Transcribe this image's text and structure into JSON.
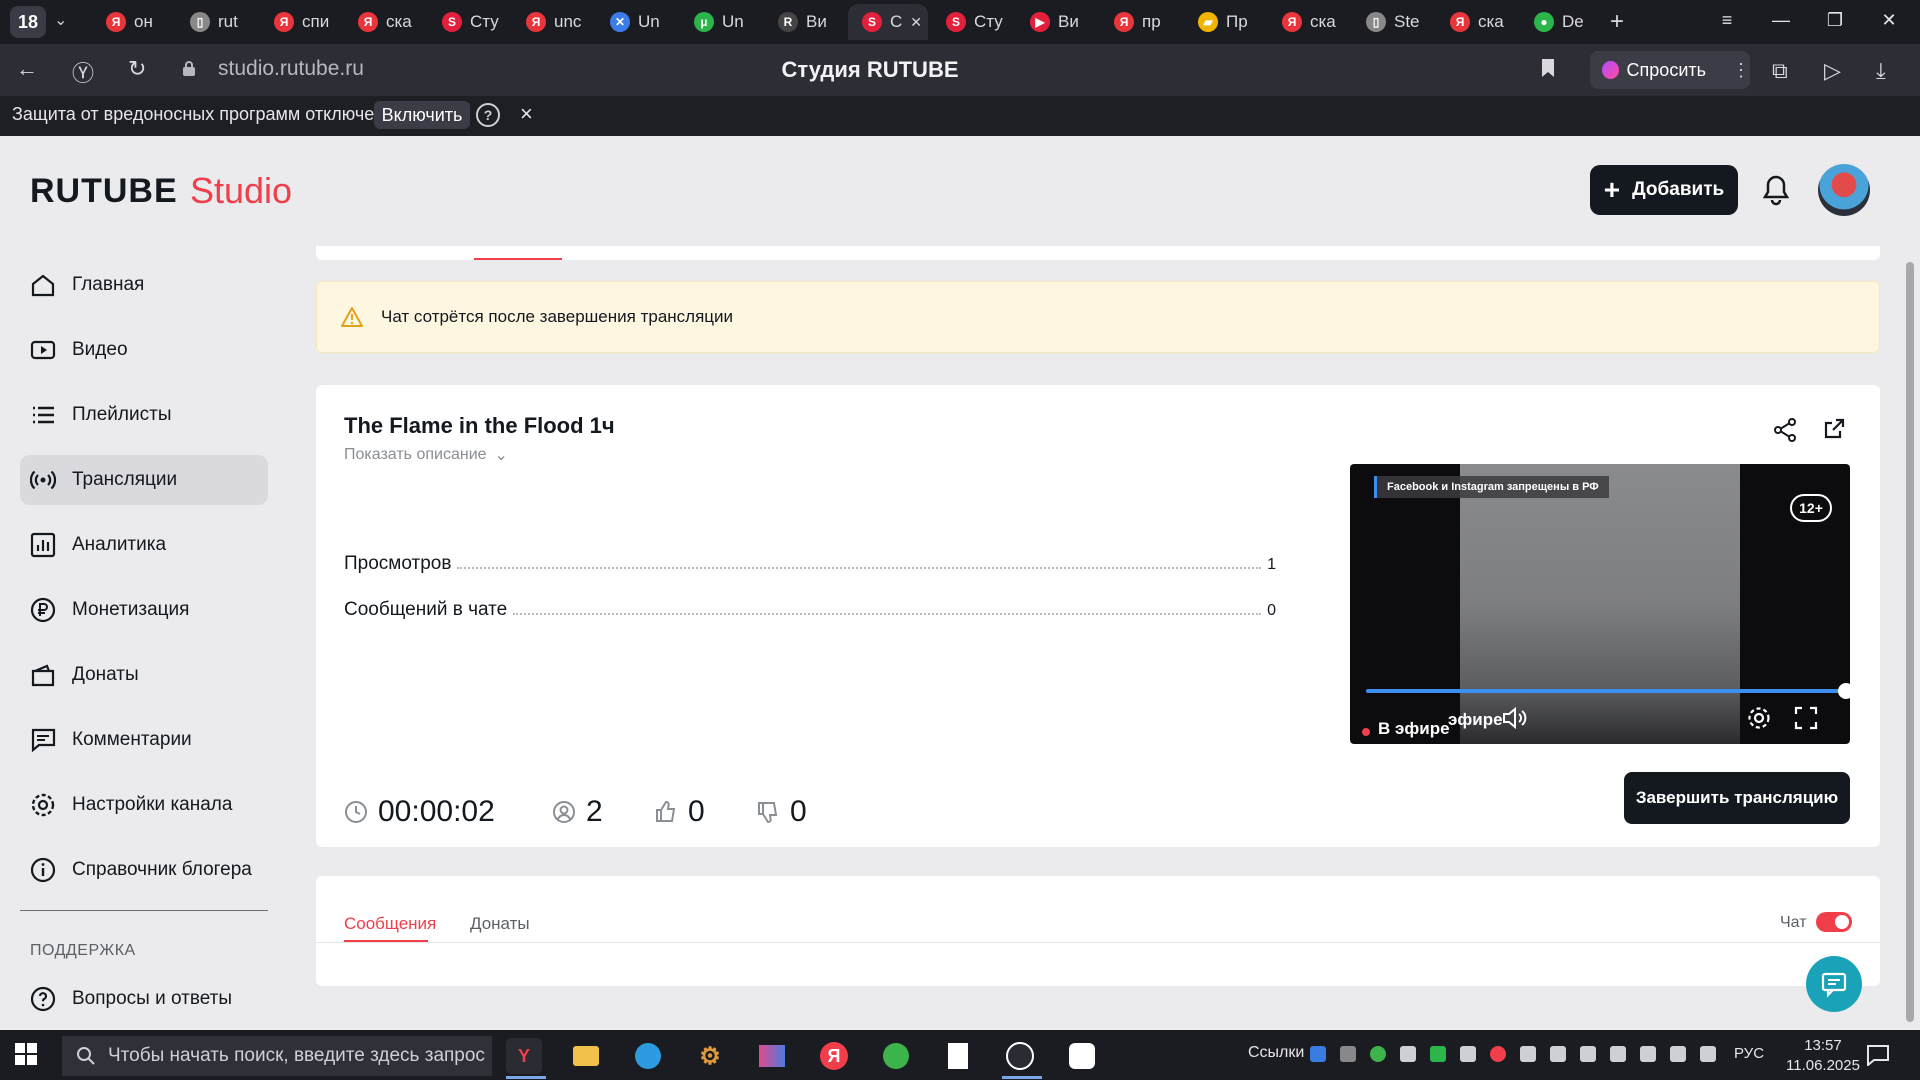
{
  "browser": {
    "tab_count": "18",
    "tabs": [
      {
        "label": "он",
        "fav_color": "#e8343a",
        "fav": "Я"
      },
      {
        "label": "rut",
        "fav_color": "#888",
        "fav": "▯"
      },
      {
        "label": "спи",
        "fav_color": "#e8343a",
        "fav": "Я"
      },
      {
        "label": "ска",
        "fav_color": "#e8343a",
        "fav": "Я"
      },
      {
        "label": "Сту",
        "fav_color": "#e3203c",
        "fav": "S"
      },
      {
        "label": "unc",
        "fav_color": "#e8343a",
        "fav": "Я"
      },
      {
        "label": "Un",
        "fav_color": "#3d7be8",
        "fav": "✕"
      },
      {
        "label": "Un",
        "fav_color": "#2bb54a",
        "fav": "µ"
      },
      {
        "label": "Ви",
        "fav_color": "#444",
        "fav": "R"
      },
      {
        "label": "С",
        "fav_color": "#e3203c",
        "fav": "S"
      },
      {
        "label": "Сту",
        "fav_color": "#e3203c",
        "fav": "S"
      },
      {
        "label": "Ви",
        "fav_color": "#e3203c",
        "fav": "▶"
      },
      {
        "label": "пр",
        "fav_color": "#e8343a",
        "fav": "Я"
      },
      {
        "label": "Пр",
        "fav_color": "#f0b400",
        "fav": "▰"
      },
      {
        "label": "ска",
        "fav_color": "#e8343a",
        "fav": "Я"
      },
      {
        "label": "Ste",
        "fav_color": "#888",
        "fav": "▯"
      },
      {
        "label": "ска",
        "fav_color": "#e8343a",
        "fav": "Я"
      },
      {
        "label": "De",
        "fav_color": "#2bb54a",
        "fav": "●"
      }
    ],
    "active_tab_index": 9,
    "url": "studio.rutube.ru",
    "page_title": "Студия RUTUBE",
    "ask_label": "Спросить",
    "protection_text": "Защита от вредоносных программ отключена",
    "protection_button": "Включить"
  },
  "header": {
    "logo_main": "RUTUBE",
    "logo_sub": "Studio",
    "add_button": "Добавить"
  },
  "sidebar": {
    "items": [
      {
        "label": "Главная",
        "icon": "home-icon"
      },
      {
        "label": "Видео",
        "icon": "video-icon"
      },
      {
        "label": "Плейлисты",
        "icon": "playlist-icon"
      },
      {
        "label": "Трансляции",
        "icon": "broadcast-icon",
        "active": true
      },
      {
        "label": "Аналитика",
        "icon": "analytics-icon"
      },
      {
        "label": "Монетизация",
        "icon": "ruble-icon"
      },
      {
        "label": "Донаты",
        "icon": "wallet-icon"
      },
      {
        "label": "Комментарии",
        "icon": "comment-icon"
      },
      {
        "label": "Настройки канала",
        "icon": "gear-icon"
      },
      {
        "label": "Справочник блогера",
        "icon": "info-icon"
      }
    ],
    "support_heading": "ПОДДЕРЖКА",
    "support_items": [
      {
        "label": "Вопросы и ответы",
        "icon": "help-icon"
      }
    ]
  },
  "warning": {
    "text": "Чат сотрётся после завершения трансляции"
  },
  "stream": {
    "title": "The Flame in the Flood 1ч",
    "show_description": "Показать описание",
    "stats": [
      {
        "label": "Просмотров",
        "value": "1"
      },
      {
        "label": "Сообщений в чате",
        "value": "0"
      }
    ],
    "metrics": {
      "duration": "00:00:02",
      "viewers": "2",
      "likes": "0",
      "dislikes": "0"
    },
    "end_button": "Завершить трансляцию",
    "player": {
      "banner": "Facebook и Instagram запрещены в РФ",
      "age_rating": "12+",
      "live_label": "В эфире",
      "live_label_back": "эфире",
      "progress": 1.0
    }
  },
  "chat": {
    "tabs": [
      "Сообщения",
      "Донаты"
    ],
    "toggle_label": "Чат",
    "toggle_on": true
  },
  "taskbar": {
    "search_placeholder": "Чтобы начать поиск, введите здесь запрос",
    "links_label": "Ссылки",
    "language": "РУС",
    "time": "13:57",
    "date": "11.06.2025"
  },
  "colors": {
    "accent": "#f03e4b",
    "dark": "#14191f",
    "player_progress": "#3e8ef0"
  }
}
